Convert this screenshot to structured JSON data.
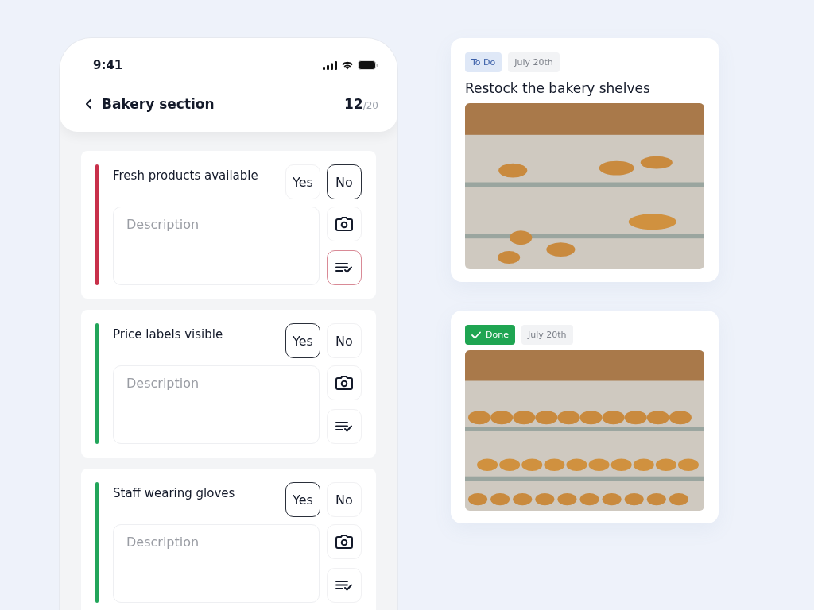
{
  "phone": {
    "status_bar": {
      "time": "9:41"
    },
    "header": {
      "title": "Bakery section",
      "progress_done": "12",
      "progress_total": "/20"
    },
    "checklist": [
      {
        "question": "Fresh products available",
        "color": "#c8304a",
        "options": [
          {
            "label": "Yes",
            "selected": false
          },
          {
            "label": "No",
            "selected": true
          }
        ],
        "placeholder": "Description",
        "task_flagged": true
      },
      {
        "question": "Price labels visible",
        "color": "#22a55a",
        "options": [
          {
            "label": "Yes",
            "selected": true
          },
          {
            "label": "No",
            "selected": false
          }
        ],
        "placeholder": "Description",
        "task_flagged": false
      },
      {
        "question": "Staff wearing gloves",
        "color": "#22a55a",
        "options": [
          {
            "label": "Yes",
            "selected": true
          },
          {
            "label": "No",
            "selected": false
          }
        ],
        "placeholder": "Description",
        "task_flagged": false
      }
    ]
  },
  "tasks": [
    {
      "status": {
        "kind": "todo",
        "label": "To Do"
      },
      "date": "July 20th",
      "title": "Restock the bakery shelves"
    },
    {
      "status": {
        "kind": "done",
        "label": "Done"
      },
      "date": "July 20th"
    }
  ]
}
